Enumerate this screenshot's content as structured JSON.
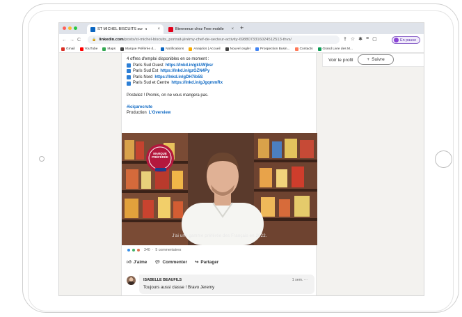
{
  "browser": {
    "tabs": [
      {
        "title": "ST MICHEL BISCUITS sur",
        "extra": "◂",
        "active": true
      },
      {
        "title": "Bienvenue chez Free mobile",
        "active": false
      }
    ],
    "new_tab": "+",
    "url_host": "linkedin.com",
    "url_path": "/posts/st-michel-biscuits_portrait-jérémy-chef-de-secteur-activity-6988073316024512513-thvs/",
    "profile_status": "En pause",
    "bookmarks": [
      {
        "label": "Gmail",
        "color": "#d93025"
      },
      {
        "label": "YouTube",
        "color": "#ff0000"
      },
      {
        "label": "Maps",
        "color": "#34a853"
      },
      {
        "label": "Marque Préférée d...",
        "color": "#444444"
      },
      {
        "label": "Notifications",
        "color": "#0a66c2"
      },
      {
        "label": "Analytics | Accueil",
        "color": "#f9ab00"
      },
      {
        "label": "Nouvel onglet",
        "color": "#444444"
      },
      {
        "label": "Prospection Busin...",
        "color": "#4285f4"
      },
      {
        "label": "Contacts",
        "color": "#ff7a59"
      },
      {
        "label": "Grand Livre des M...",
        "color": "#0f9d58"
      }
    ]
  },
  "post": {
    "intro": "4 offres d'emploi disponibles en ce moment :",
    "offers": [
      {
        "region": "Paris Sud Ouest",
        "url": "https://lnkd.in/gkUWjksr"
      },
      {
        "region": "Paris Sud Est",
        "url": "https://lnkd.in/gzGZN4Py"
      },
      {
        "region": "Paris Nord",
        "url": "https://lnkd.in/gDH7ib5S"
      },
      {
        "region": "Paris Sud et Centre",
        "url": "https://lnkd.in/gJgqmmRx"
      }
    ],
    "cta": "Postulez ! Promis, on ne vous mangera pas.",
    "hashtag": "#iciçarecrute",
    "production_label": "Production",
    "production_link": "L'Overview",
    "video_badge_line1": "MARQUE",
    "video_badge_line2": "PRÉFÉRÉE",
    "video_caption": "J'ai une gamme préférée des Français en 2022.",
    "reaction_count": "340",
    "comments_count": "5 commentaires",
    "actions": {
      "like": "J'aime",
      "comment": "Commenter",
      "share": "Partager"
    },
    "comment": {
      "author": "ISABELLE BEAUFILS",
      "time": "1 sem.",
      "more": "···",
      "text": "Toujours aussi classe ! Bravo Jeremy"
    }
  },
  "sidebar": {
    "view_profile": "Voir le profil",
    "follow": "Suivre"
  },
  "colors": {
    "linkedin_blue": "#0a66c2",
    "accent_purple": "#8b44d6"
  }
}
